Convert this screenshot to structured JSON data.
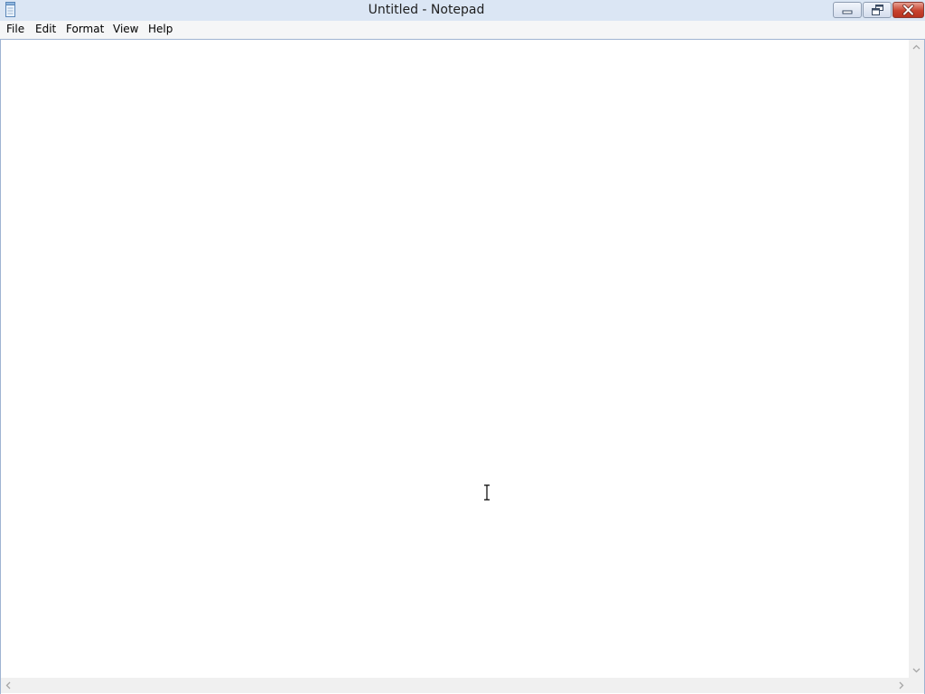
{
  "window": {
    "title": "Untitled - Notepad",
    "app_icon": "notepad-icon"
  },
  "caption_buttons": {
    "minimize_icon": "minimize-icon",
    "restore_icon": "restore-icon",
    "close_icon": "close-icon",
    "close_color": "#c7432f"
  },
  "menu": {
    "items": [
      {
        "label": "File"
      },
      {
        "label": "Edit"
      },
      {
        "label": "Format"
      },
      {
        "label": "View"
      },
      {
        "label": "Help"
      }
    ]
  },
  "editor": {
    "content": ""
  },
  "colors": {
    "titlebar": "#dbe6f4",
    "frame_border": "#9fb4d2",
    "menubar": "#f5f6f7"
  }
}
